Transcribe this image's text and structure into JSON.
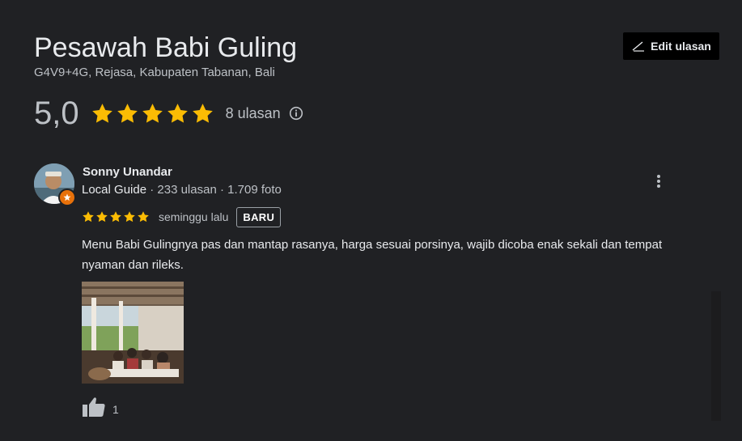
{
  "place": {
    "name": "Pesawah Babi Guling",
    "address": "G4V9+4G, Rejasa, Kabupaten Tabanan, Bali"
  },
  "actions": {
    "edit_label": "Edit ulasan",
    "edit_icon": "pencil-icon"
  },
  "rating": {
    "value": "5,0",
    "stars": 5,
    "review_count": "8 ulasan",
    "info_icon": "info-icon"
  },
  "review": {
    "author": "Sonny Unandar",
    "guide_label": "Local Guide",
    "stats": " · 233 ulasan · 1.709 foto",
    "stars": 5,
    "time": "seminggu lalu",
    "badge": "BARU",
    "text": "Menu Babi Gulingnya pas dan mantap rasanya, harga sesuai porsinya, wajib dicoba enak sekali dan tempat nyaman dan rileks.",
    "likes": "1",
    "more_icon": "more-vert-icon",
    "like_icon": "thumb-up-icon"
  },
  "colors": {
    "background": "#202124",
    "star": "#fbbc04",
    "text_primary": "#e8eaed",
    "text_secondary": "#bdc1c6",
    "guide_badge": "#e8710a"
  }
}
